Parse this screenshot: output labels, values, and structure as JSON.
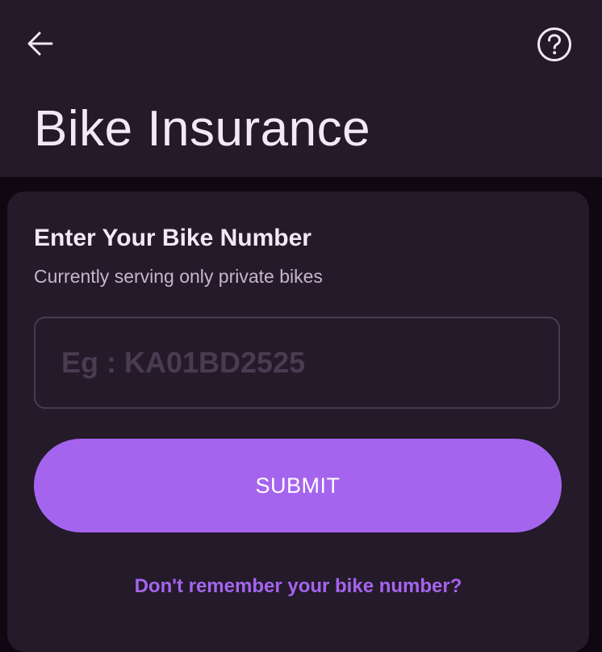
{
  "header": {
    "title": "Bike Insurance",
    "back_icon": "arrow-left-icon",
    "help_icon": "question-circle-icon"
  },
  "form": {
    "heading": "Enter Your Bike Number",
    "subheading": "Currently serving only private bikes",
    "input_placeholder": "Eg : KA01BD2525",
    "input_value": "",
    "submit_label": "SUBMIT",
    "forgot_link": "Don't remember your bike number?"
  },
  "colors": {
    "background": "#0f0812",
    "surface": "#241a2a",
    "accent": "#a564ee",
    "text_primary": "#f3e8f6",
    "text_secondary": "#c6b5cd",
    "input_border": "#4a3a54"
  }
}
